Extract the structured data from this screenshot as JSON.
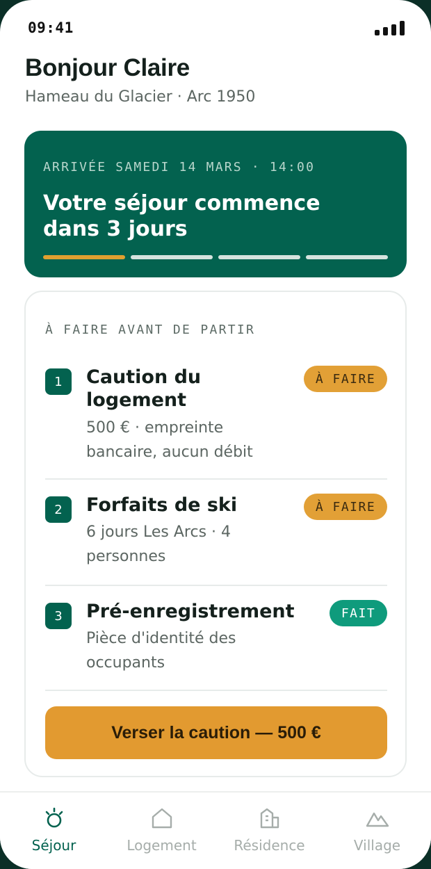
{
  "status_bar": {
    "time": "09:41"
  },
  "header": {
    "greeting": "Bonjour Claire",
    "location": "Hameau du Glacier · Arc 1950"
  },
  "hero": {
    "eyebrow": "ARRIVÉE SAMEDI 14 MARS · 14:00",
    "title": "Votre séjour commence dans 3 jours",
    "progress_steps": 4,
    "progress_active": 1,
    "accent_color": "#e0a030",
    "background_color": "#03624f"
  },
  "checklist": {
    "eyebrow": "À FAIRE AVANT DE PARTIR",
    "tasks": [
      {
        "number": "1",
        "title": "Caution du logement",
        "description": "500 € · empreinte bancaire, aucun débit",
        "status": "À FAIRE"
      },
      {
        "number": "2",
        "title": "Forfaits de ski",
        "description": "6 jours Les Arcs · 4 personnes",
        "status": "À FAIRE"
      },
      {
        "number": "3",
        "title": "Pré-enregistrement",
        "description": "Pièce d'identité des occupants",
        "status": "FAIT"
      }
    ],
    "cta_label": "Verser la caution — 500 €"
  },
  "tabbar": {
    "items": [
      {
        "label": "Séjour",
        "icon": "sun-icon",
        "active": true
      },
      {
        "label": "Logement",
        "icon": "house-icon",
        "active": false
      },
      {
        "label": "Résidence",
        "icon": "building-icon",
        "active": false
      },
      {
        "label": "Village",
        "icon": "mountain-icon",
        "active": false
      }
    ]
  }
}
